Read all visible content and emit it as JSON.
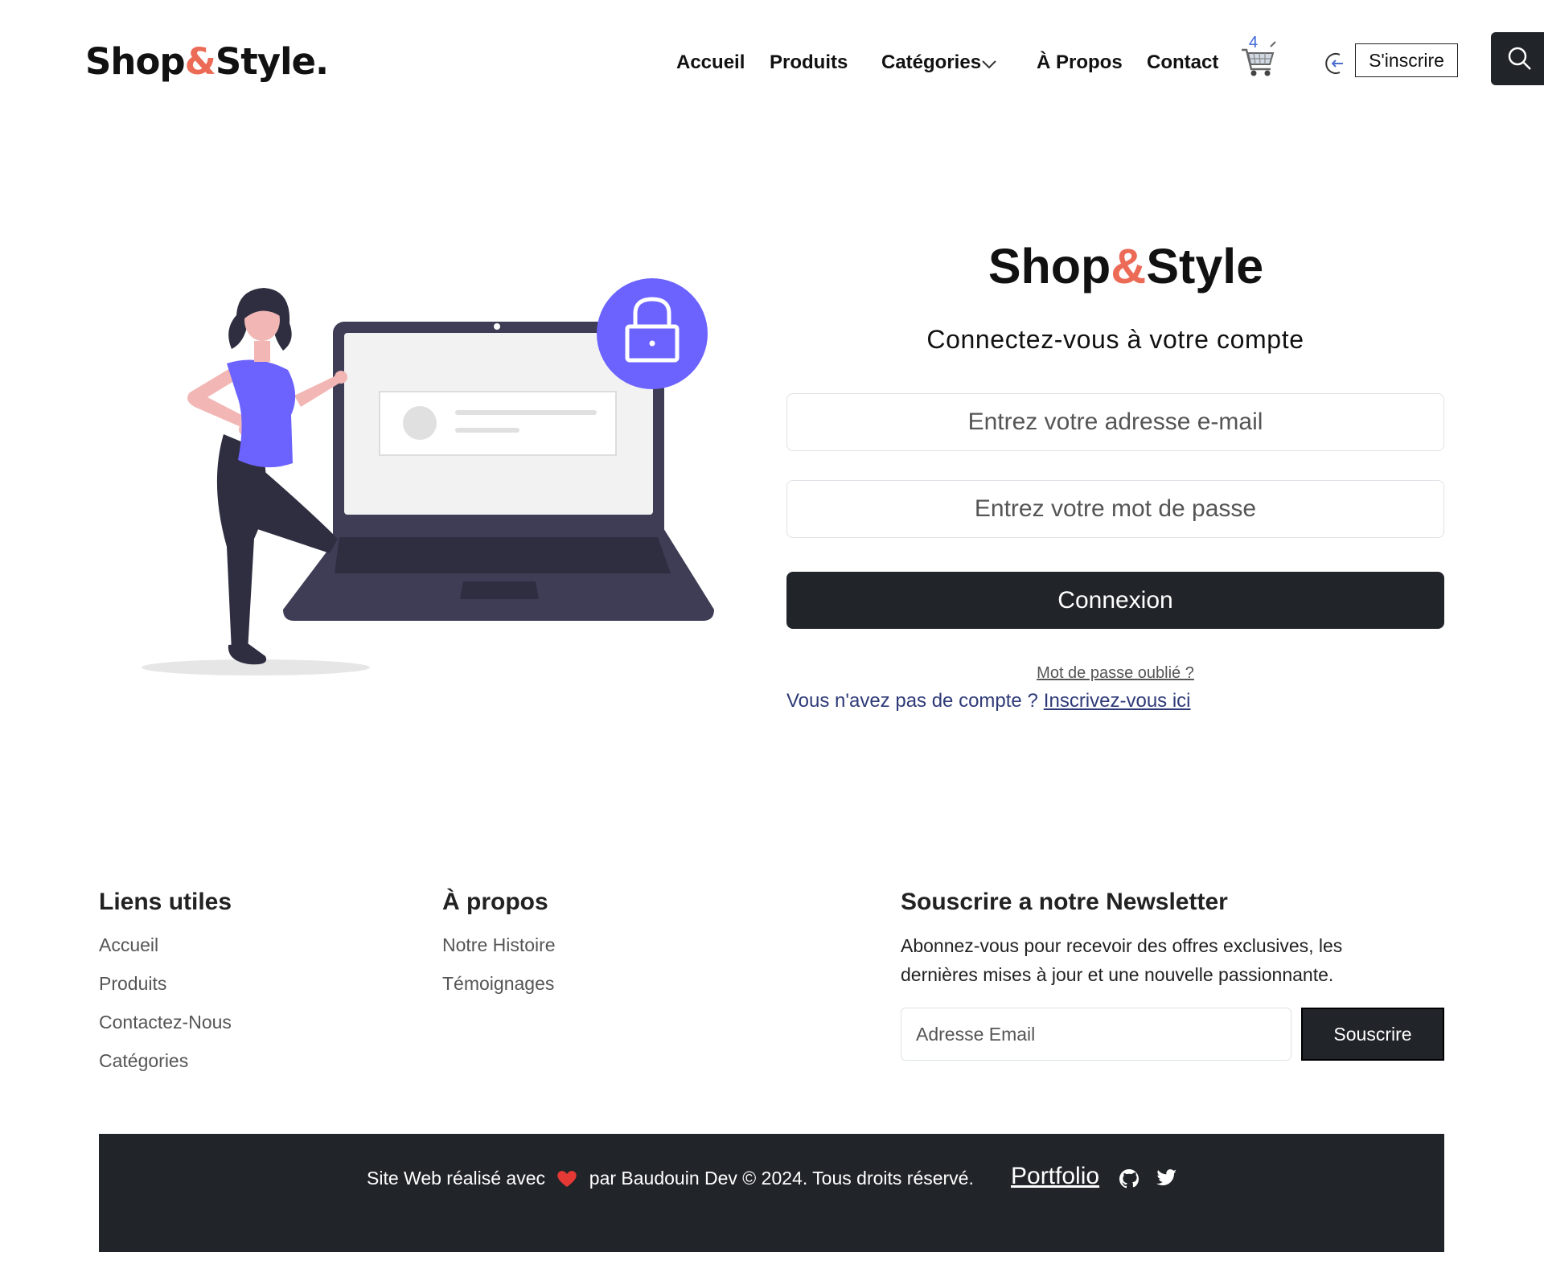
{
  "brand": {
    "name_left": "Shop",
    "amp": "&",
    "name_right": "Style",
    "dot": ".",
    "accent_color": "#ec6b56"
  },
  "nav": {
    "home": "Accueil",
    "products": "Produits",
    "categories": "Catégories",
    "about": "À Propos",
    "contact": "Contact",
    "cart_count": "4",
    "signup": "S'inscrire"
  },
  "login": {
    "title_left": "Shop",
    "title_amp": "&",
    "title_right": "Style",
    "subtitle": "Connectez-vous à votre compte",
    "email_placeholder": "Entrez votre adresse e-mail",
    "password_placeholder": "Entrez votre mot de passe",
    "submit": "Connexion",
    "forgot": "Mot de passe oublié ?",
    "no_account": "Vous n'avez pas de compte ?",
    "signup_link": "Inscrivez-vous ici"
  },
  "footer": {
    "useful_links": {
      "heading": "Liens utiles",
      "items": [
        "Accueil",
        "Produits",
        "Contactez-Nous",
        "Catégories"
      ]
    },
    "about": {
      "heading": "À propos",
      "items": [
        "Notre Histoire",
        "Témoignages"
      ]
    },
    "newsletter": {
      "heading": "Souscrire a notre Newsletter",
      "text": "Abonnez-vous pour recevoir des offres exclusives, les dernières mises à jour et une nouvelle passionnante.",
      "input_placeholder": "Adresse Email",
      "button": "Souscrire"
    },
    "credit_before": "Site Web réalisé avec",
    "credit_after": "par Baudouin Dev © 2024. Tous droits réservé.",
    "portfolio": "Portfolio"
  },
  "icons": {
    "cart": "shopping-cart-icon",
    "login": "login-arrow-icon",
    "search": "search-icon",
    "chevron": "chevron-down-icon",
    "heart": "heart-icon",
    "github": "github-icon",
    "twitter": "twitter-icon",
    "lock": "lock-icon"
  },
  "colors": {
    "dark": "#212529",
    "purple": "#6c63ff",
    "skin": "#f2b7b5",
    "hair": "#2f2e41"
  }
}
